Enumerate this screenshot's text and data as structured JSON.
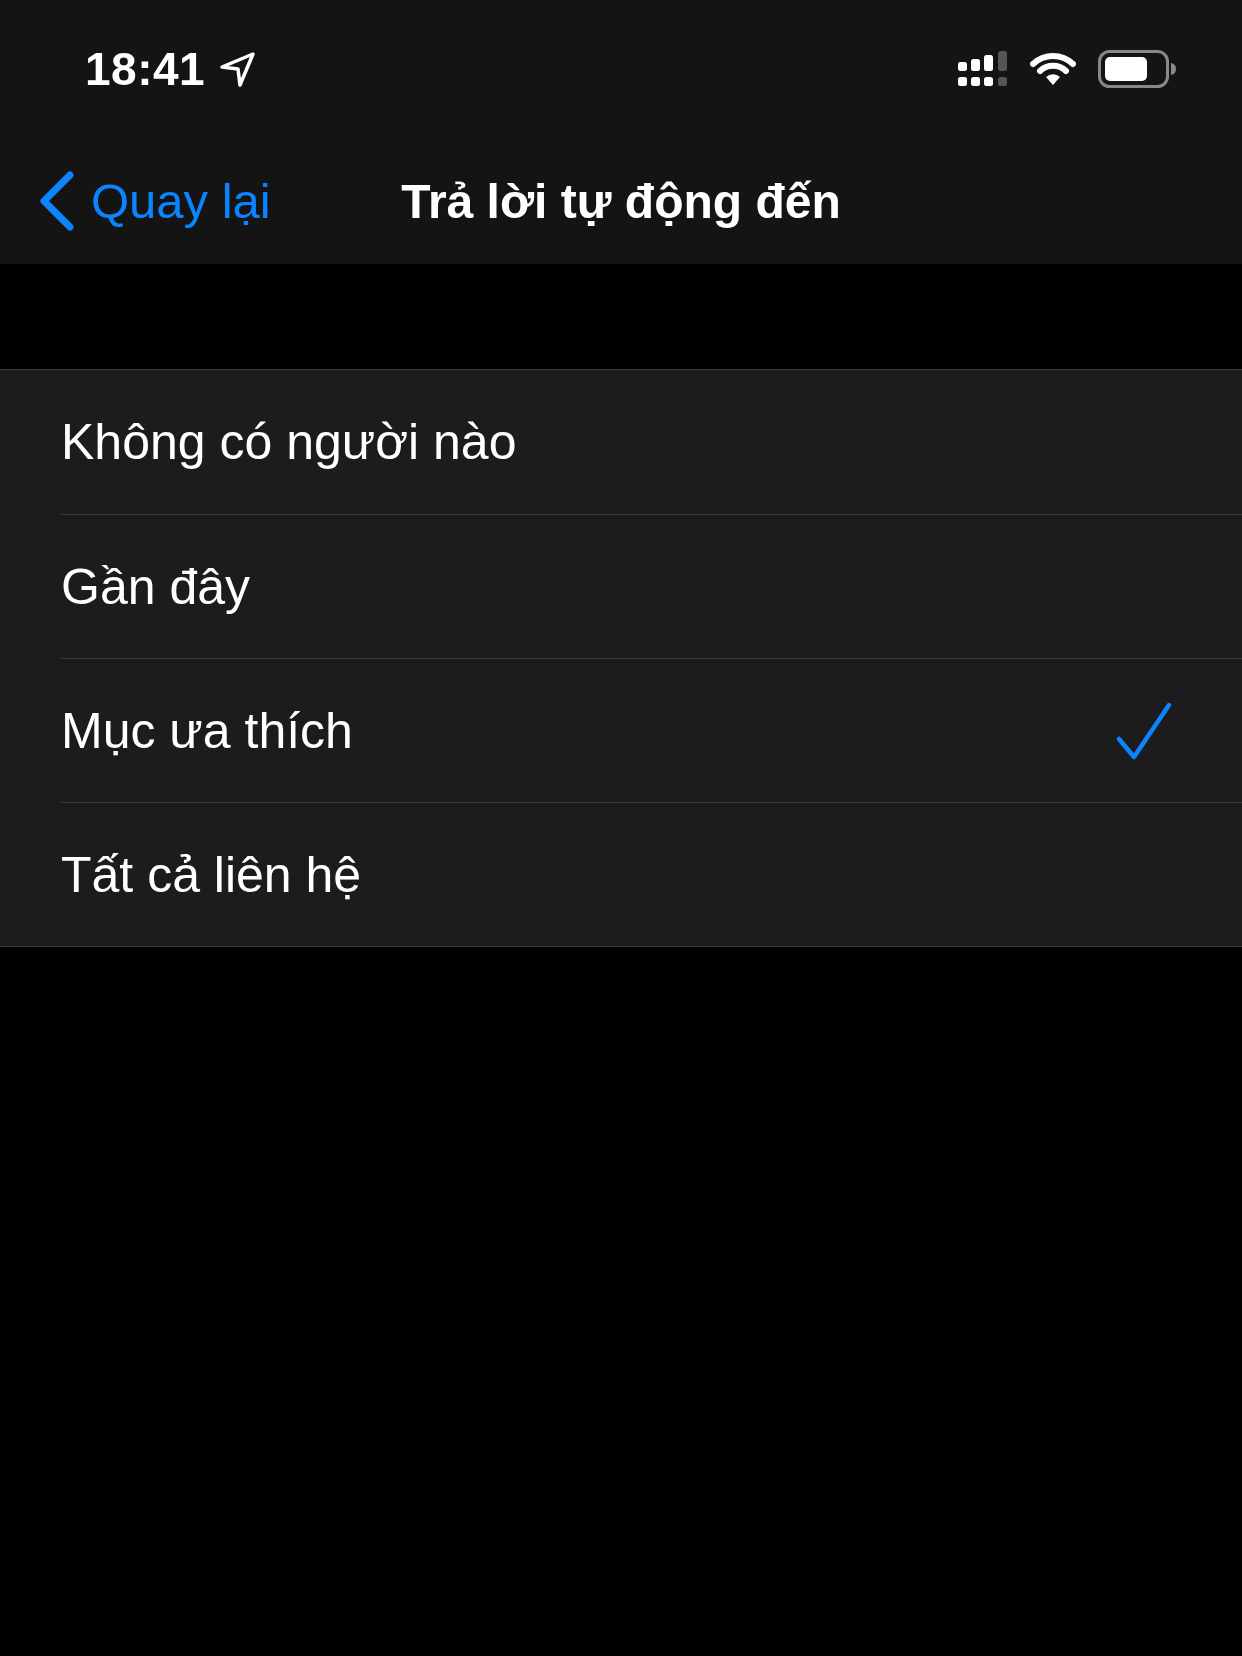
{
  "status_bar": {
    "time": "18:41"
  },
  "nav_bar": {
    "back": "Quay lại",
    "title": "Trả lời tự động đến"
  },
  "options": [
    {
      "label": "Không có người nào",
      "selected": false
    },
    {
      "label": "Gần đây",
      "selected": false
    },
    {
      "label": "Mục ưa thích",
      "selected": true
    },
    {
      "label": "Tất cả liên hệ",
      "selected": false
    }
  ]
}
